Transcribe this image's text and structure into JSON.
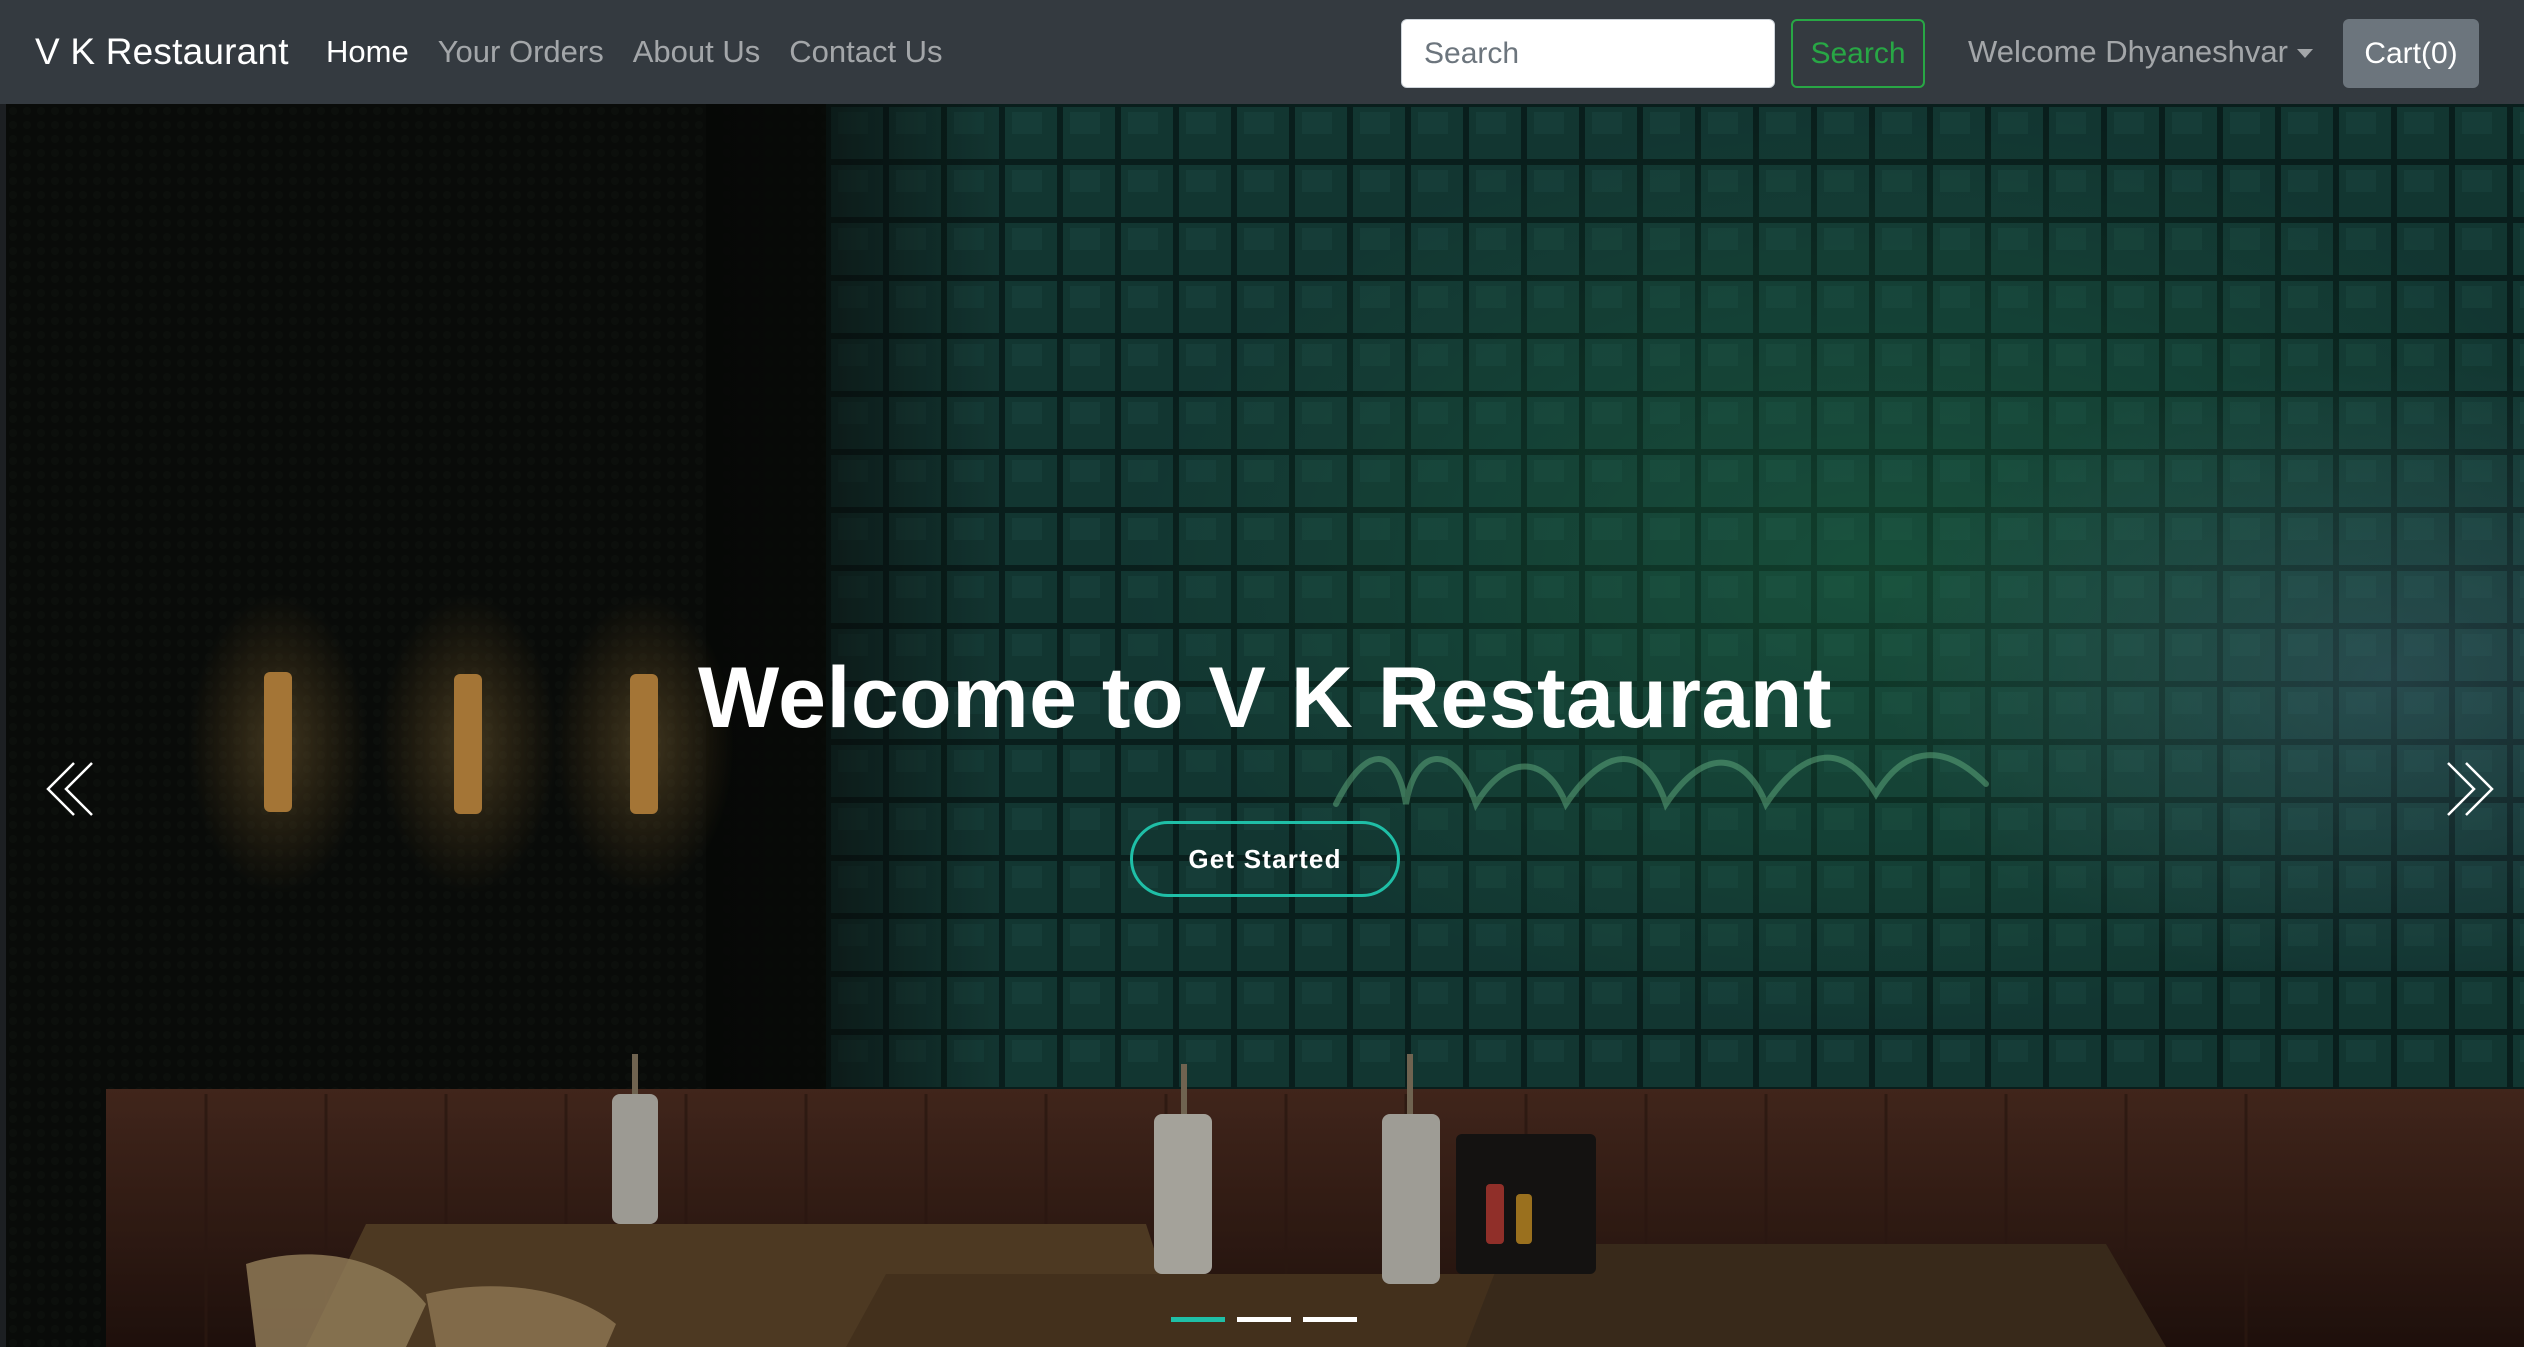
{
  "navbar": {
    "brand": "V K Restaurant",
    "links": [
      {
        "label": "Home",
        "active": true
      },
      {
        "label": "Your Orders",
        "active": false
      },
      {
        "label": "About Us",
        "active": false
      },
      {
        "label": "Contact Us",
        "active": false
      }
    ],
    "search_placeholder": "Search",
    "search_button": "Search",
    "welcome": "Welcome Dhyaneshvar",
    "cart": "Cart(0)"
  },
  "hero": {
    "title": "Welcome to V K Restaurant",
    "cta": "Get Started",
    "slides": 3,
    "active_slide": 1
  },
  "colors": {
    "navbar_bg": "#343a40",
    "search_accent": "#28a745",
    "cart_bg": "#6c757d",
    "hero_accent": "#1fbfa7"
  }
}
